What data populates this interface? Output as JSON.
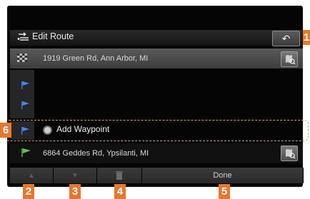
{
  "header": {
    "title": "Edit Route",
    "back_symbol": "↶"
  },
  "route": {
    "start": {
      "address": "1919 Green Rd, Ann Arbor, MI"
    },
    "waypoint": {
      "label": "Add Waypoint"
    },
    "destination": {
      "address": "6864 Geddes Rd, Ypsilanti, MI"
    }
  },
  "toolbar": {
    "up_symbol": "▲",
    "down_symbol": "▼",
    "done_label": "Done"
  },
  "callouts": {
    "back": "1",
    "up": "2",
    "down": "3",
    "delete": "4",
    "done": "5",
    "waypoint": "6"
  },
  "icons": {
    "route": "edit-route-icon",
    "start": "checkered-flag-icon",
    "destination": "green-flag-icon",
    "waypoint": "blue-flag-icon",
    "map_search": "map-search-icon",
    "trash": "trash-icon"
  },
  "colors": {
    "callout": "#e8772e",
    "highlight_border": "#d9a56c"
  }
}
